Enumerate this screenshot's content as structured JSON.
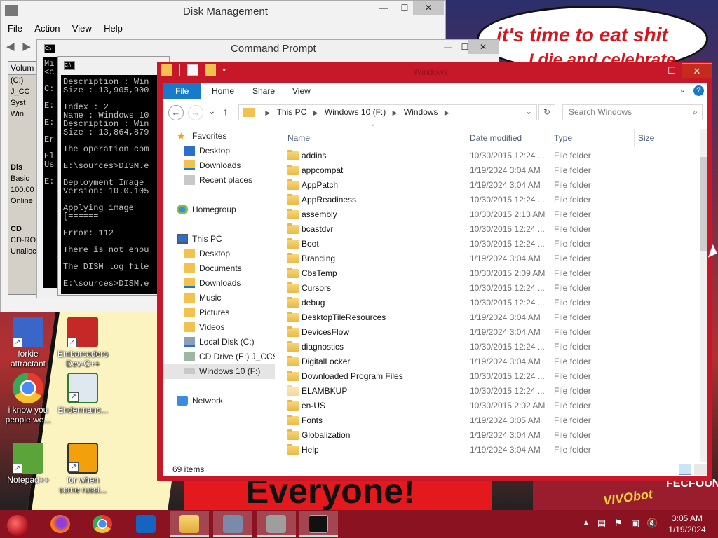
{
  "wallpaper": {
    "bubble_line1": "it's time to eat shit",
    "bubble_line2": "I die and celebrate",
    "banner_text": "Everyone!",
    "right_text": "VIVObot",
    "right_text2": "FECFOUN"
  },
  "desktop_icons": [
    {
      "label": "forkie attractant",
      "color": "#3a66c9"
    },
    {
      "label": "Embarcadero Dev-C++",
      "color": "#c62828"
    },
    {
      "label": "i know you people we...",
      "color": "#e33b2e"
    },
    {
      "label": "Endermanc...",
      "color": "#2e7d32"
    },
    {
      "label": "Notepad++",
      "color": "#5aa43a"
    },
    {
      "label": "for when some russi...",
      "color": "#f2a10d"
    }
  ],
  "disk_mgmt": {
    "title": "Disk Management",
    "menu": [
      "File",
      "Action",
      "View",
      "Help"
    ],
    "pane_header": "Volum",
    "volumes": [
      "(C:)",
      "J_CC",
      "Syst",
      "Win"
    ],
    "disk_label": "Dis",
    "disk_type": "Basic",
    "disk_size": "100.00",
    "disk_state": "Online",
    "cd_label": "CD",
    "cd_name": "CD-ROM",
    "unalloc": "Unalloca"
  },
  "cmd_back": {
    "title": "Command Prompt",
    "lines": "Mi\n<c\n\nC:\n\nE:\n\nE:\n\nEr\n\nEl\nUs\n\nE:"
  },
  "cmd_front": {
    "lines": "Description : Win\nSize : 13,905,900\n\nIndex : 2\nName : Windows 10\nDescription : Win\nSize : 13,864,879\n\nThe operation com\n\nE:\\sources>DISM.e\n\nDeployment Image\nVersion: 10.0.105\n\nApplying image\n[======\n\nError: 112\n\nThere is not enou\n\nThe DISM log file\n\nE:\\sources>DISM.e"
  },
  "explorer": {
    "title": "Windows",
    "tabs": [
      "File",
      "Home",
      "Share",
      "View"
    ],
    "address": [
      "This PC",
      "Windows 10 (F:)",
      "Windows"
    ],
    "search_placeholder": "Search Windows",
    "columns": {
      "name": "Name",
      "date": "Date modified",
      "type": "Type",
      "size": "Size"
    },
    "nav": {
      "favorites": "Favorites",
      "fav_items": [
        "Desktop",
        "Downloads",
        "Recent places"
      ],
      "homegroup": "Homegroup",
      "thispc": "This PC",
      "pc_items": [
        "Desktop",
        "Documents",
        "Downloads",
        "Music",
        "Pictures",
        "Videos",
        "Local Disk (C:)",
        "CD Drive (E:) J_CCSA",
        "Windows 10 (F:)"
      ],
      "network": "Network"
    },
    "files": [
      {
        "name": "addins",
        "date": "10/30/2015 12:24 ...",
        "type": "File folder"
      },
      {
        "name": "appcompat",
        "date": "1/19/2024 3:04 AM",
        "type": "File folder"
      },
      {
        "name": "AppPatch",
        "date": "1/19/2024 3:04 AM",
        "type": "File folder"
      },
      {
        "name": "AppReadiness",
        "date": "10/30/2015 12:24 ...",
        "type": "File folder"
      },
      {
        "name": "assembly",
        "date": "10/30/2015 2:13 AM",
        "type": "File folder"
      },
      {
        "name": "bcastdvr",
        "date": "10/30/2015 12:24 ...",
        "type": "File folder"
      },
      {
        "name": "Boot",
        "date": "10/30/2015 12:24 ...",
        "type": "File folder"
      },
      {
        "name": "Branding",
        "date": "1/19/2024 3:04 AM",
        "type": "File folder"
      },
      {
        "name": "CbsTemp",
        "date": "10/30/2015 2:09 AM",
        "type": "File folder"
      },
      {
        "name": "Cursors",
        "date": "10/30/2015 12:24 ...",
        "type": "File folder"
      },
      {
        "name": "debug",
        "date": "10/30/2015 12:24 ...",
        "type": "File folder"
      },
      {
        "name": "DesktopTileResources",
        "date": "1/19/2024 3:04 AM",
        "type": "File folder"
      },
      {
        "name": "DevicesFlow",
        "date": "1/19/2024 3:04 AM",
        "type": "File folder"
      },
      {
        "name": "diagnostics",
        "date": "10/30/2015 12:24 ...",
        "type": "File folder"
      },
      {
        "name": "DigitalLocker",
        "date": "1/19/2024 3:04 AM",
        "type": "File folder"
      },
      {
        "name": "Downloaded Program Files",
        "date": "10/30/2015 12:24 ...",
        "type": "File folder"
      },
      {
        "name": "ELAMBKUP",
        "date": "10/30/2015 12:24 ...",
        "type": "File folder"
      },
      {
        "name": "en-US",
        "date": "10/30/2015 2:02 AM",
        "type": "File folder"
      },
      {
        "name": "Fonts",
        "date": "1/19/2024 3:05 AM",
        "type": "File folder"
      },
      {
        "name": "Globalization",
        "date": "1/19/2024 3:04 AM",
        "type": "File folder"
      },
      {
        "name": "Help",
        "date": "1/19/2024 3:04 AM",
        "type": "File folder"
      }
    ],
    "item_count": "69 items"
  },
  "taskbar": {
    "apps": [
      {
        "name": "firefox",
        "color": "#ff7b16"
      },
      {
        "name": "chrome",
        "color": "#3aa757"
      },
      {
        "name": "outlook",
        "color": "#1565c0"
      },
      {
        "name": "file-explorer",
        "color": "#f2c14e"
      },
      {
        "name": "control-panel",
        "color": "#7a8aa8"
      },
      {
        "name": "disk-management",
        "color": "#9e9e9e"
      },
      {
        "name": "command-prompt",
        "color": "#111111"
      }
    ],
    "time": "3:05 AM",
    "date": "1/19/2024"
  },
  "colors": {
    "explorer_frame": "#c7182a",
    "taskbar": "#8b1220",
    "ribbon_file": "#1979ca"
  }
}
